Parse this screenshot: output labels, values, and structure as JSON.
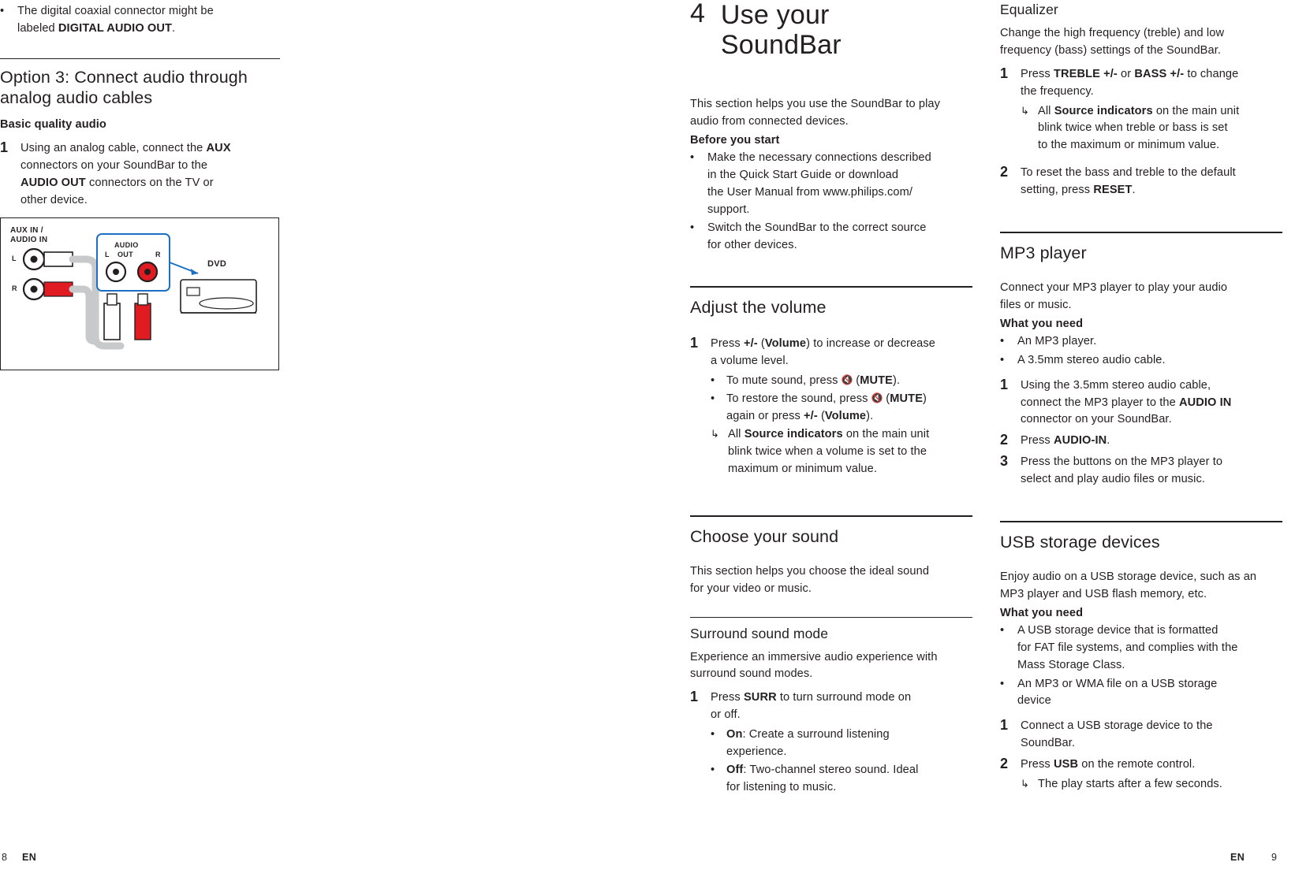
{
  "document": {
    "footer": {
      "left_page": "8",
      "left_lang": "EN",
      "right_lang": "EN",
      "right_page": "9"
    }
  },
  "left_column": {
    "top_bullet": {
      "mark": "•",
      "text_1": "The digital coaxial connector might be",
      "text_2": "labeled ",
      "bold_2": "DIGITAL AUDIO OUT",
      "text_3": "."
    },
    "heading": "Option 3: Connect audio through analog audio cables",
    "subheading": "Basic quality audio",
    "step1": {
      "num": "1",
      "line1_a": "Using an analog cable, connect the ",
      "line1_b": "AUX",
      "line2_a": "connectors on your SoundBar to the",
      "line3_a": "AUDIO OUT",
      "line3_b": " connectors on the TV or",
      "line4_a": "other device."
    },
    "figure": {
      "label_aux": "AUX IN /",
      "label_audio_in": "AUDIO IN",
      "label_l": "L",
      "label_r": "R",
      "label_audio": "AUDIO",
      "label_out": "OUT",
      "label_jack_l": "L",
      "label_jack_r": "R",
      "label_dvd": "DVD"
    }
  },
  "mid_column": {
    "chapter": {
      "number": "4",
      "title_line1": "Use your",
      "title_line2": "SoundBar"
    },
    "intro_line1": "This section helps you use the SoundBar to play",
    "intro_line2": "audio from connected devices.",
    "before_you_start": "Before you start",
    "before_bullets": [
      {
        "mark": "•",
        "lines": [
          "Make the necessary connections described",
          "in the Quick Start Guide or download",
          "the User Manual from www.philips.com/",
          "support."
        ]
      },
      {
        "mark": "•",
        "lines": [
          "Switch the SoundBar to the correct source",
          "for other devices."
        ]
      }
    ],
    "adjust_volume": {
      "heading": "Adjust the volume",
      "step1_num": "1",
      "step1_l1_a": "Press ",
      "step1_l1_b": "+/-",
      "step1_l1_c": " (",
      "step1_l1_d": "Volume",
      "step1_l1_e": ") to increase or decrease",
      "step1_l2": "a volume level.",
      "sub1_mark": "•",
      "sub1_a": "To mute sound, press ",
      "sub1_icon": "mute-icon",
      "sub1_b": " (",
      "sub1_c": "MUTE",
      "sub1_d": ").",
      "sub2_mark": "•",
      "sub2_a": "To restore the sound, press ",
      "sub2_icon": "mute-icon",
      "sub2_b": " (",
      "sub2_c": "MUTE",
      "sub2_d": ")",
      "sub2_l2_a": "again or press ",
      "sub2_l2_b": "+/-",
      "sub2_l2_c": " (",
      "sub2_l2_d": "Volume",
      "sub2_l2_e": ").",
      "arrow_mark": "↳",
      "arrow_a": "All ",
      "arrow_b": "Source indicators",
      "arrow_c": " on the main unit",
      "arrow_l2": "blink twice when a volume is set to the",
      "arrow_l3": "maximum or minimum value."
    },
    "choose_sound": {
      "heading": "Choose your sound",
      "intro_l1": "This section helps you choose the ideal sound",
      "intro_l2": "for your video or music.",
      "sub_heading": "Surround sound mode",
      "sub_intro_l1": "Experience an immersive audio experience with",
      "sub_intro_l2": "surround sound modes.",
      "step1_num": "1",
      "step1_l1_a": "Press ",
      "step1_l1_b": "SURR",
      "step1_l1_c": " to turn surround mode on",
      "step1_l2": "or off.",
      "opt1_mark": "•",
      "opt1_b": "On",
      "opt1_a": ": Create a surround listening",
      "opt1_l2": "experience.",
      "opt2_mark": "•",
      "opt2_b": "Off",
      "opt2_a": ": Two-channel stereo sound. Ideal",
      "opt2_l2": "for listening to music."
    }
  },
  "right_column": {
    "equalizer": {
      "heading": "Equalizer",
      "intro_l1": "Change the high frequency (treble) and low",
      "intro_l2": "frequency (bass) settings of the SoundBar.",
      "step1_num": "1",
      "step1_a": "Press ",
      "step1_b": "TREBLE +/-",
      "step1_c": " or ",
      "step1_d": "BASS +/-",
      "step1_e": " to change",
      "step1_l2": "the frequency.",
      "arrow_mark": "↳",
      "arrow_a": "All ",
      "arrow_b": "Source indicators",
      "arrow_c": " on the main unit",
      "arrow_l2": "blink twice when treble or bass is set",
      "arrow_l3": "to the maximum or minimum value.",
      "step2_num": "2",
      "step2_l1": "To reset the bass and treble to the default",
      "step2_l2_a": "setting, press ",
      "step2_l2_b": "RESET",
      "step2_l2_c": "."
    },
    "mp3": {
      "heading": "MP3 player",
      "intro_l1": "Connect your MP3 player to play your audio",
      "intro_l2": "files or music.",
      "what_you_need": "What you need",
      "bullets": [
        {
          "mark": "•",
          "text": "An MP3 player."
        },
        {
          "mark": "•",
          "text": "A 3.5mm stereo audio cable."
        }
      ],
      "step1_num": "1",
      "step1_l1": "Using the 3.5mm stereo audio cable,",
      "step1_l2_a": "connect the MP3 player to the ",
      "step1_l2_b": "AUDIO IN",
      "step1_l3": "connector on your SoundBar.",
      "step2_num": "2",
      "step2_a": "Press ",
      "step2_b": "AUDIO-IN",
      "step2_c": ".",
      "step3_num": "3",
      "step3_l1": "Press the buttons on the MP3 player to",
      "step3_l2": "select and play audio files or music."
    },
    "usb": {
      "heading": "USB storage devices",
      "intro_l1": "Enjoy audio on a USB storage device, such as an",
      "intro_l2": "MP3 player and USB flash memory, etc.",
      "what_you_need": "What you need",
      "bullets": [
        {
          "mark": "•",
          "lines": [
            "A USB storage device that is formatted",
            "for FAT file systems, and complies with the",
            "Mass Storage Class."
          ]
        },
        {
          "mark": "•",
          "lines": [
            "An MP3 or WMA file on a USB storage",
            "device"
          ]
        }
      ],
      "step1_num": "1",
      "step1_l1": "Connect a USB storage device to the",
      "step1_l2": "SoundBar.",
      "step2_num": "2",
      "step2_a": "Press ",
      "step2_b": "USB",
      "step2_c": " on the remote control.",
      "arrow_mark": "↳",
      "arrow_text": "The play starts after a few seconds."
    }
  }
}
